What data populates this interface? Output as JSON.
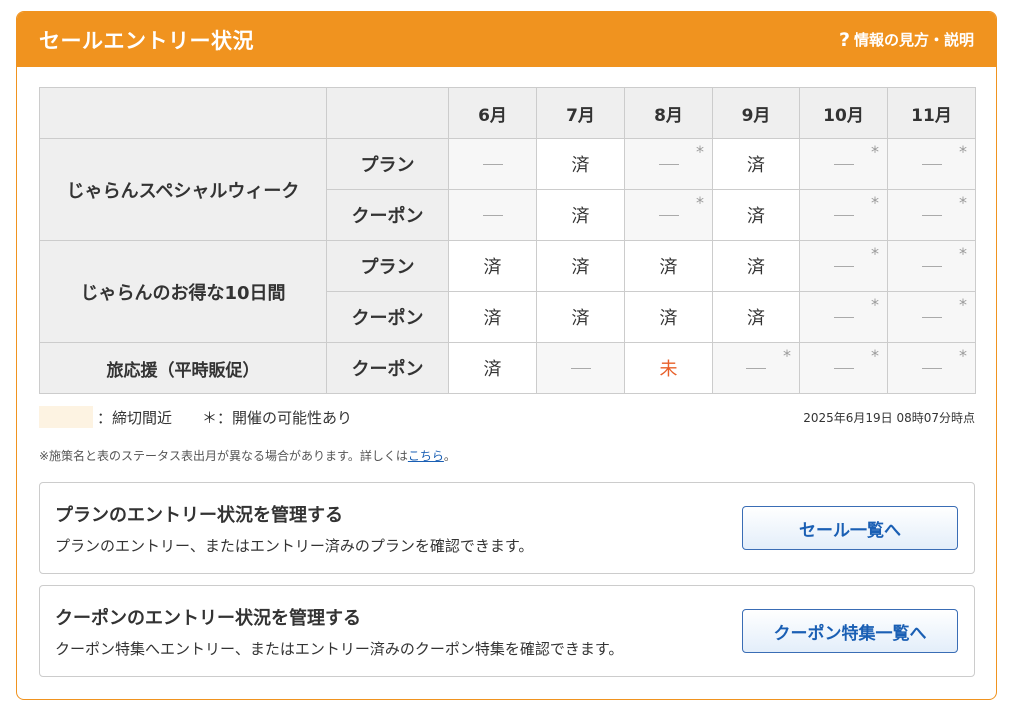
{
  "header": {
    "title": "セールエントリー状況",
    "help_icon": "?",
    "help_label": "情報の見方・説明"
  },
  "table": {
    "months": [
      "6月",
      "7月",
      "8月",
      "9月",
      "10月",
      "11月"
    ],
    "rows": [
      {
        "sale": "じゃらんスペシャルウィーク",
        "type": "プラン",
        "cells": [
          {
            "v": "—",
            "ast": false
          },
          {
            "v": "済",
            "ast": false
          },
          {
            "v": "—",
            "ast": true
          },
          {
            "v": "済",
            "ast": false
          },
          {
            "v": "—",
            "ast": true
          },
          {
            "v": "—",
            "ast": true
          }
        ]
      },
      {
        "sale": "じゃらんスペシャルウィーク",
        "type": "クーポン",
        "cells": [
          {
            "v": "—",
            "ast": false
          },
          {
            "v": "済",
            "ast": false
          },
          {
            "v": "—",
            "ast": true
          },
          {
            "v": "済",
            "ast": false
          },
          {
            "v": "—",
            "ast": true
          },
          {
            "v": "—",
            "ast": true
          }
        ]
      },
      {
        "sale": "じゃらんのお得な10日間",
        "type": "プラン",
        "cells": [
          {
            "v": "済",
            "ast": false
          },
          {
            "v": "済",
            "ast": false
          },
          {
            "v": "済",
            "ast": false
          },
          {
            "v": "済",
            "ast": false
          },
          {
            "v": "—",
            "ast": true
          },
          {
            "v": "—",
            "ast": true
          }
        ]
      },
      {
        "sale": "じゃらんのお得な10日間",
        "type": "クーポン",
        "cells": [
          {
            "v": "済",
            "ast": false
          },
          {
            "v": "済",
            "ast": false
          },
          {
            "v": "済",
            "ast": false
          },
          {
            "v": "済",
            "ast": false
          },
          {
            "v": "—",
            "ast": true
          },
          {
            "v": "—",
            "ast": true
          }
        ]
      },
      {
        "sale": "旅応援（平時販促）",
        "type": "クーポン",
        "cells": [
          {
            "v": "済",
            "ast": false
          },
          {
            "v": "—",
            "ast": false
          },
          {
            "v": "未",
            "ast": false
          },
          {
            "v": "—",
            "ast": true
          },
          {
            "v": "—",
            "ast": true
          },
          {
            "v": "—",
            "ast": true
          }
        ]
      }
    ],
    "asterisk": "*"
  },
  "legend": {
    "deadline_label": "：締切間近",
    "possible_label": "＊：開催の可能性あり",
    "timestamp": "2025年6月19日 08時07分時点"
  },
  "note": {
    "text": "※施策名と表のステータス表出月が異なる場合があります。詳しくは",
    "link": "こちら",
    "end": "。"
  },
  "cards": [
    {
      "title": "プランのエントリー状況を管理する",
      "desc": "プランのエントリー、またはエントリー済みのプランを確認できます。",
      "button": "セール一覧へ"
    },
    {
      "title": "クーポンのエントリー状況を管理する",
      "desc": "クーポン特集へエントリー、またはエントリー済みのクーポン特集を確認できます。",
      "button": "クーポン特集一覧へ"
    }
  ],
  "colors": {
    "accent": "#f0931f",
    "link": "#1a5fb4",
    "unfinished": "#e8602a",
    "deadline_bg": "#fdf3e2"
  }
}
